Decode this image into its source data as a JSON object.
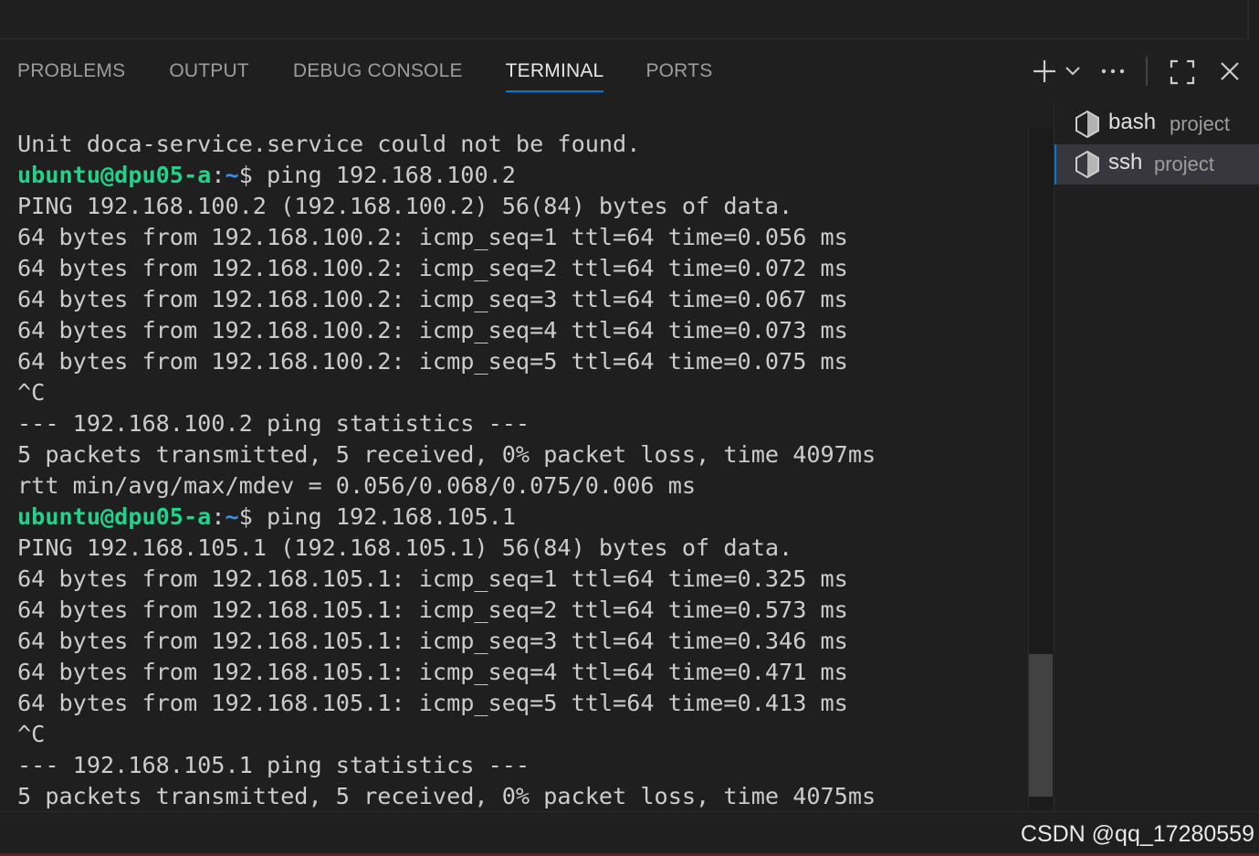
{
  "panel": {
    "tabs": [
      "PROBLEMS",
      "OUTPUT",
      "DEBUG CONSOLE",
      "TERMINAL",
      "PORTS"
    ],
    "active_tab": "TERMINAL"
  },
  "actions": {
    "icons": [
      "plus-icon",
      "chevron-down-icon",
      "more-icon",
      "maximize-icon",
      "close-icon"
    ]
  },
  "terminal": {
    "prompt_user": "ubuntu@dpu05-a",
    "prompt_path": "~",
    "prompt_symbol": "$",
    "lines": [
      {
        "text": "Unit doca-service.service could not be found."
      },
      {
        "prompt": true,
        "text": " ping 192.168.100.2"
      },
      {
        "text": "PING 192.168.100.2 (192.168.100.2) 56(84) bytes of data."
      },
      {
        "text": "64 bytes from 192.168.100.2: icmp_seq=1 ttl=64 time=0.056 ms"
      },
      {
        "text": "64 bytes from 192.168.100.2: icmp_seq=2 ttl=64 time=0.072 ms"
      },
      {
        "text": "64 bytes from 192.168.100.2: icmp_seq=3 ttl=64 time=0.067 ms"
      },
      {
        "text": "64 bytes from 192.168.100.2: icmp_seq=4 ttl=64 time=0.073 ms"
      },
      {
        "text": "64 bytes from 192.168.100.2: icmp_seq=5 ttl=64 time=0.075 ms"
      },
      {
        "text": "^C"
      },
      {
        "text": "--- 192.168.100.2 ping statistics ---"
      },
      {
        "text": "5 packets transmitted, 5 received, 0% packet loss, time 4097ms"
      },
      {
        "text": "rtt min/avg/max/mdev = 0.056/0.068/0.075/0.006 ms"
      },
      {
        "prompt": true,
        "text": " ping 192.168.105.1"
      },
      {
        "text": "PING 192.168.105.1 (192.168.105.1) 56(84) bytes of data."
      },
      {
        "text": "64 bytes from 192.168.105.1: icmp_seq=1 ttl=64 time=0.325 ms"
      },
      {
        "text": "64 bytes from 192.168.105.1: icmp_seq=2 ttl=64 time=0.573 ms"
      },
      {
        "text": "64 bytes from 192.168.105.1: icmp_seq=3 ttl=64 time=0.346 ms"
      },
      {
        "text": "64 bytes from 192.168.105.1: icmp_seq=4 ttl=64 time=0.471 ms"
      },
      {
        "text": "64 bytes from 192.168.105.1: icmp_seq=5 ttl=64 time=0.413 ms"
      },
      {
        "text": "^C"
      },
      {
        "text": "--- 192.168.105.1 ping statistics ---"
      },
      {
        "text": "5 packets transmitted, 5 received, 0% packet loss, time 4075ms"
      }
    ]
  },
  "terminal_list": [
    {
      "name": "bash",
      "description": "project",
      "icon": "terminal-shell-icon",
      "active": false
    },
    {
      "name": "ssh",
      "description": "project",
      "icon": "terminal-shell-icon",
      "active": true
    }
  ],
  "watermark": "CSDN @qq_17280559",
  "colors": {
    "background": "#1f1f1f",
    "accent": "#0078d4",
    "prompt_user": "#23d18b",
    "prompt_path": "#3b8eea"
  }
}
